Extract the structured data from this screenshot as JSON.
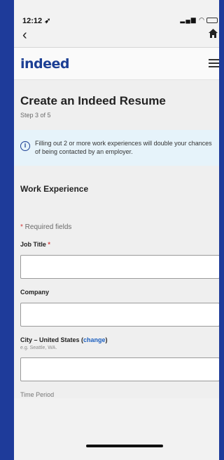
{
  "status": {
    "time": "12:12",
    "time_icon": "location-arrow-icon",
    "signal": "signal-wifi-battery"
  },
  "browser": {
    "back_icon": "chevron-left-icon",
    "home_icon": "home-icon"
  },
  "header": {
    "logo": "indeed",
    "menu_icon": "hamburger-icon"
  },
  "page": {
    "title": "Create an Indeed Resume",
    "step": "Step 3 of 5",
    "notice": "Filling out 2 or more work experiences will double your chances of being contacted by an employer.",
    "section_title": "Work Experience",
    "required_star": "*",
    "required_text": " Required fields",
    "fields": {
      "job_title": {
        "label": "Job Title",
        "star": " *",
        "value": ""
      },
      "company": {
        "label": "Company",
        "value": ""
      },
      "city": {
        "label": "City – United States ",
        "change_open": "(",
        "change": "change",
        "change_close": ")",
        "hint": "e.g. Seattle, WA.",
        "value": ""
      }
    },
    "partial_label": "Time Period"
  },
  "colors": {
    "brand": "#1c3f94",
    "background": "#1e3b9a",
    "notice": "#e6f3fa"
  }
}
